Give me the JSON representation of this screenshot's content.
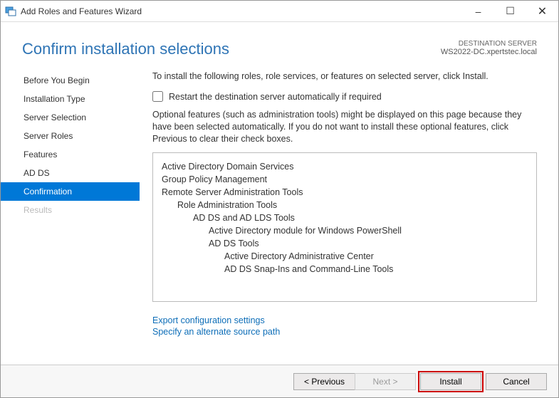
{
  "window": {
    "title": "Add Roles and Features Wizard"
  },
  "header": {
    "headline": "Confirm installation selections",
    "dest_label": "DESTINATION SERVER",
    "dest_value": "WS2022-DC.xpertstec.local"
  },
  "sidebar": {
    "steps": [
      {
        "label": "Before You Begin",
        "state": "enabled"
      },
      {
        "label": "Installation Type",
        "state": "enabled"
      },
      {
        "label": "Server Selection",
        "state": "enabled"
      },
      {
        "label": "Server Roles",
        "state": "enabled"
      },
      {
        "label": "Features",
        "state": "enabled"
      },
      {
        "label": "AD DS",
        "state": "enabled"
      },
      {
        "label": "Confirmation",
        "state": "selected"
      },
      {
        "label": "Results",
        "state": "disabled"
      }
    ]
  },
  "content": {
    "intro": "To install the following roles, role services, or features on selected server, click Install.",
    "restart_label": "Restart the destination server automatically if required",
    "note": "Optional features (such as administration tools) might be displayed on this page because they have been selected automatically. If you do not want to install these optional features, click Previous to clear their check boxes.",
    "features": [
      {
        "text": "Active Directory Domain Services",
        "indent": 0
      },
      {
        "text": "Group Policy Management",
        "indent": 0
      },
      {
        "text": "Remote Server Administration Tools",
        "indent": 0
      },
      {
        "text": "Role Administration Tools",
        "indent": 1
      },
      {
        "text": "AD DS and AD LDS Tools",
        "indent": 2
      },
      {
        "text": "Active Directory module for Windows PowerShell",
        "indent": 3
      },
      {
        "text": "AD DS Tools",
        "indent": 3
      },
      {
        "text": "Active Directory Administrative Center",
        "indent": 4
      },
      {
        "text": "AD DS Snap-Ins and Command-Line Tools",
        "indent": 4
      }
    ],
    "link_export": "Export configuration settings",
    "link_source": "Specify an alternate source path"
  },
  "footer": {
    "previous": "< Previous",
    "next": "Next >",
    "install": "Install",
    "cancel": "Cancel"
  }
}
